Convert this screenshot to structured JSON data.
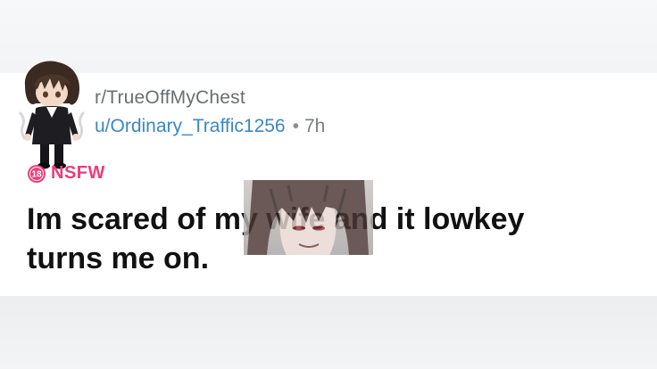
{
  "post": {
    "subreddit": "r/TrueOffMyChest",
    "username": "u/Ordinary_Traffic1256",
    "separator": "•",
    "time_ago": "7h",
    "nsfw_badge_number": "18",
    "nsfw_label": "NSFW",
    "title": "Im scared of my wife and it lowkey turns me on."
  },
  "colors": {
    "subreddit": "#6a6e72",
    "username": "#3b87c4",
    "nsfw": "#ee3b7a",
    "title": "#111111"
  },
  "icons": {
    "avatar": "anime-character-avatar",
    "nsfw": "nsfw-18-badge-icon",
    "overlay": "anime-face-overlay-image"
  }
}
